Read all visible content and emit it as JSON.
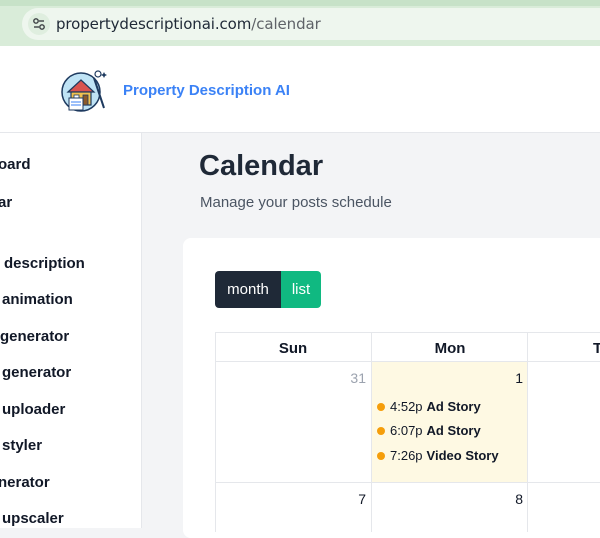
{
  "browser": {
    "url_domain": "propertydescriptionai.com",
    "url_path": "/calendar"
  },
  "header": {
    "brand": "Property Description AI",
    "logo_icon": "house-logo-icon"
  },
  "sidebar": {
    "items": [
      {
        "label": "oard"
      },
      {
        "label": "ar"
      },
      {
        "label": "description"
      },
      {
        "label": "animation"
      },
      {
        "label": "generator"
      },
      {
        "label": "generator"
      },
      {
        "label": "uploader"
      },
      {
        "label": "styler"
      },
      {
        "label": "nerator"
      },
      {
        "label": "upscaler"
      }
    ]
  },
  "page": {
    "title": "Calendar",
    "subtitle": "Manage your posts schedule"
  },
  "view_toggle": {
    "month_label": "month",
    "list_label": "list",
    "active": "month"
  },
  "calendar": {
    "weekdays": [
      "Sun",
      "Mon",
      "T"
    ],
    "weeks": [
      {
        "days": [
          {
            "num": "31",
            "muted": true
          },
          {
            "num": "1",
            "today": true,
            "events": [
              {
                "time": "4:52p",
                "title": "Ad Story"
              },
              {
                "time": "6:07p",
                "title": "Ad Story"
              },
              {
                "time": "7:26p",
                "title": "Video Story"
              }
            ]
          }
        ]
      },
      {
        "days": [
          {
            "num": "7"
          },
          {
            "num": "8"
          }
        ]
      }
    ],
    "colors": {
      "event_dot": "#f59e0b",
      "today_bg": "#fef9e3"
    }
  }
}
